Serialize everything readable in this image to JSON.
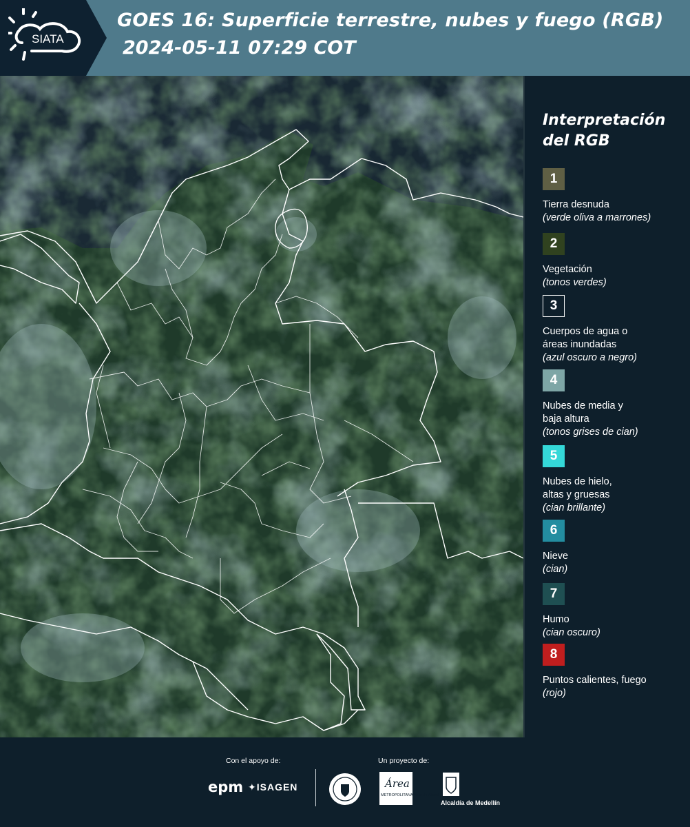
{
  "header": {
    "logo_text": "SIATA",
    "title": "GOES 16: Superficie terrestre, nubes y fuego (RGB)",
    "datetime": "2024-05-11 07:29 COT"
  },
  "map": {
    "icon": "satellite-map"
  },
  "legend": {
    "title_line1": "Interpretación",
    "title_line2": "del RGB",
    "items": [
      {
        "num": "1",
        "color": "#5f5f44",
        "label_lines": [
          "Tierra desnuda"
        ],
        "sub": "(verde oliva a marrones)"
      },
      {
        "num": "2",
        "color": "#30421f",
        "label_lines": [
          "Vegetación"
        ],
        "sub": "(tonos verdes)"
      },
      {
        "num": "3",
        "color": "#0e1f2b",
        "label_lines": [
          "Cuerpos de agua o",
          "áreas inundadas"
        ],
        "sub": "(azul oscuro a negro)"
      },
      {
        "num": "4",
        "color": "#7ea6a6",
        "label_lines": [
          "Nubes de media y",
          "baja altura"
        ],
        "sub": "(tonos grises de cian)"
      },
      {
        "num": "5",
        "color": "#34d8d8",
        "label_lines": [
          "Nubes de hielo,",
          "altas y gruesas"
        ],
        "sub": "(cian brillante)"
      },
      {
        "num": "6",
        "color": "#238da0",
        "label_lines": [
          "Nieve"
        ],
        "sub": "(cian)"
      },
      {
        "num": "7",
        "color": "#1f4f52",
        "label_lines": [
          "Humo"
        ],
        "sub": "(cian oscuro)"
      },
      {
        "num": "8",
        "color": "#c01e1e",
        "label_lines": [
          "Puntos calientes, fuego"
        ],
        "sub": "(rojo)"
      }
    ]
  },
  "footer": {
    "support_label": "Con el apoyo de:",
    "project_label": "Un proyecto de:",
    "epm": "epm",
    "isagen": "ISAGEN",
    "area_word": "Área",
    "area_sub": "METROPOLITANA Valle de Aburrá",
    "alcaldia": "Alcaldía de Medellín"
  },
  "colors": {
    "header_bg": "#4f7a8b",
    "logo_panel": "#0e2130",
    "page_bg": "#0e1f2b",
    "border_white": "#ffffff"
  }
}
